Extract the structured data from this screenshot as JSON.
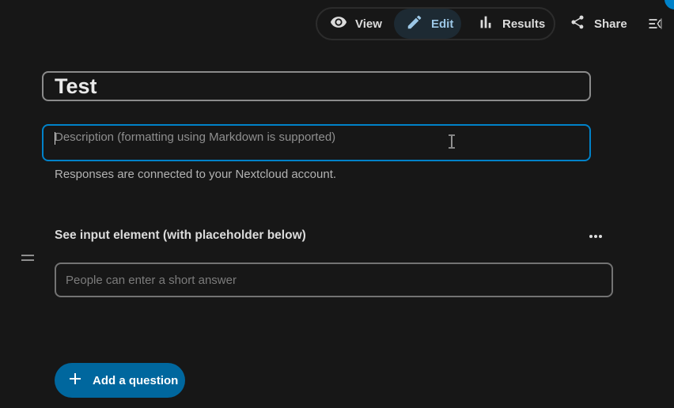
{
  "toolbar": {
    "modes": [
      {
        "label": "View",
        "icon": "eye-icon"
      },
      {
        "label": "Edit",
        "icon": "pencil-icon",
        "active": true
      },
      {
        "label": "Results",
        "icon": "bar-chart-icon"
      }
    ],
    "share_label": "Share",
    "sidebar_icon": "sidebar-toggle-icon"
  },
  "form": {
    "title": "Test",
    "description_placeholder": "Description (formatting using Markdown is supported)",
    "account_note": "Responses are connected to your Nextcloud account."
  },
  "question": {
    "title": "See input element (with placeholder below)",
    "answer_placeholder": "People can enter a short answer"
  },
  "add_question_label": "Add a question",
  "colors": {
    "background": "#171717",
    "accent": "#0082c9",
    "primary_button": "#00679e"
  }
}
